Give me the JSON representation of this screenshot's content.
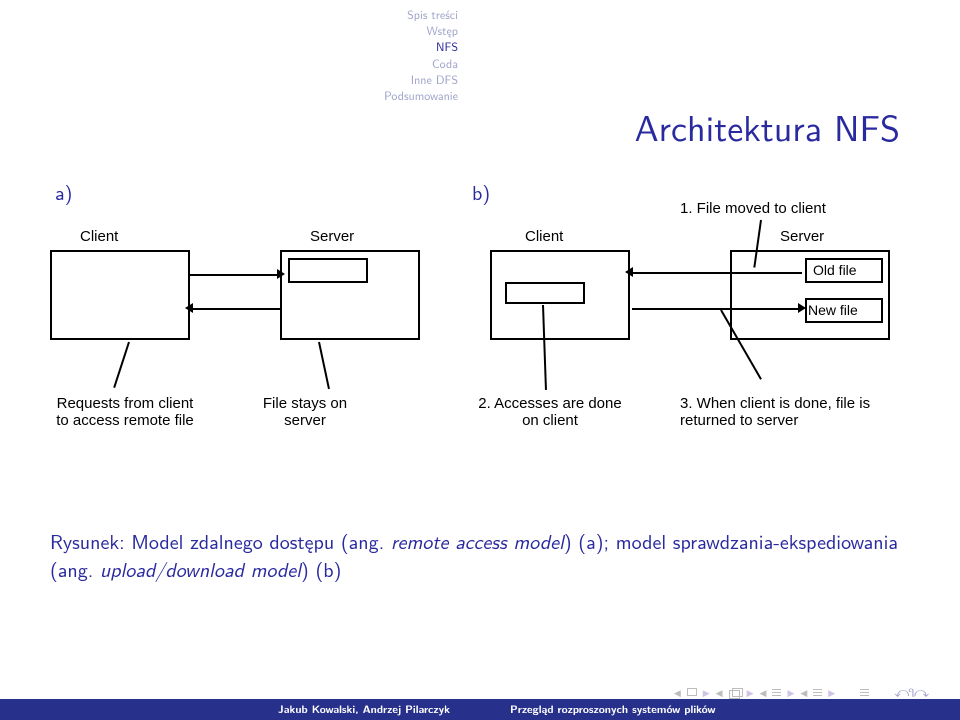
{
  "nav": {
    "items": [
      "Spis treści",
      "Wstęp",
      "NFS",
      "Coda",
      "Inne DFS",
      "Podsumowanie"
    ]
  },
  "title": "Architektura NFS",
  "fig": {
    "a_label": "a)",
    "b_label": "b)",
    "client": "Client",
    "server": "Server",
    "a_req": "Requests from client to access remote file",
    "a_stay": "File stays on server",
    "b_1": "1. File moved to client",
    "b_2": "2. Accesses are done on client",
    "b_3": "3. When client is done, file is returned to server",
    "old": "Old file",
    "new": "New file"
  },
  "caption": {
    "prefix": "Rysunek:",
    "body1": " Model zdalnego dostępu (ang. ",
    "em1": "remote access model",
    "body2": ") (a); model sprawdzania-ekspediowania (ang. ",
    "em2": "upload/download model",
    "body3": ") (b)"
  },
  "footer": {
    "left": "Jakub Kowalski, Andrzej Pilarczyk",
    "right": "Przegląd rozproszonych systemów plików"
  }
}
